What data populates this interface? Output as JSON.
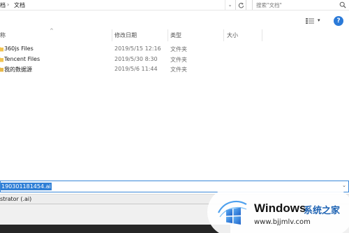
{
  "address_bar": {
    "crumb_prefix": "档",
    "separator": "›",
    "current_folder": "文档",
    "dropdown_icon": "chevron-down-icon",
    "refresh_icon": "refresh-icon",
    "search_placeholder": "搜索\"文档\"",
    "search_icon": "search-icon"
  },
  "toolbar": {
    "view_icon": "view-options-icon",
    "view_chevron": "▾",
    "help_label": "?"
  },
  "columns": {
    "name": "称",
    "date_modified": "修改日期",
    "type": "类型",
    "size": "大小",
    "sort_arrow": "^"
  },
  "files": [
    {
      "name": "360js Files",
      "date": "2019/5/15 12:16",
      "type": "文件夹"
    },
    {
      "name": "Tencent Files",
      "date": "2019/5/30 8:30",
      "type": "文件夹"
    },
    {
      "name": "我的数据源",
      "date": "2019/5/6 11:44",
      "type": "文件夹"
    }
  ],
  "filename_field": {
    "value": "190301181454.ai",
    "dropdown_icon": "chevron-down-icon"
  },
  "save_type": {
    "value": "strator (.ai)"
  },
  "watermark": {
    "brand": "Windows",
    "cn_text": "系统之家",
    "url": "www.bjjmlv.com"
  },
  "colors": {
    "selection_blue": "#2f7fd6",
    "folder_yellow": "#f2c450",
    "help_blue": "#2b7ad8",
    "watermark_blue": "#1e63b3"
  }
}
